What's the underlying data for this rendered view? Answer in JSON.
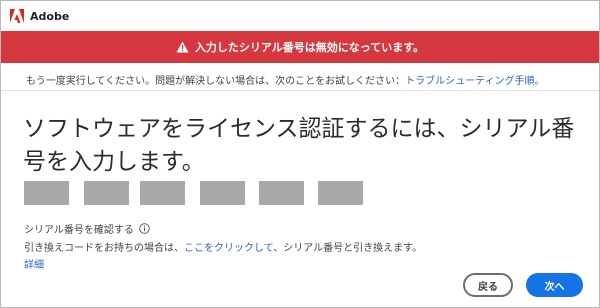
{
  "app": {
    "title": "Adobe",
    "brand_color": "#e1251b"
  },
  "banner": {
    "message": "入力したシリアル番号は無効になっています。",
    "background_color": "#d7373f",
    "icon": "warning-icon"
  },
  "retry": {
    "text": "もう一度実行してください。問題が解決しない場合は、次のことをお試しください：",
    "link_label": "トラブルシューティング手順。",
    "link_color": "#2f64c8"
  },
  "main": {
    "heading": "ソフトウェアをライセンス認証するには、シリアル番号を入力します。",
    "serial_field_count": 6
  },
  "verify": {
    "label": "シリアル番号を確認する",
    "icon": "info-icon"
  },
  "exchange": {
    "prefix": "引き換えコードをお持ちの場合は、",
    "link_label": "ここをクリックして",
    "suffix": "、シリアル番号と引き換えます。"
  },
  "details": {
    "label": "詳細"
  },
  "buttons": {
    "back_label": "戻る",
    "next_label": "次へ",
    "next_color": "#1473e6"
  }
}
